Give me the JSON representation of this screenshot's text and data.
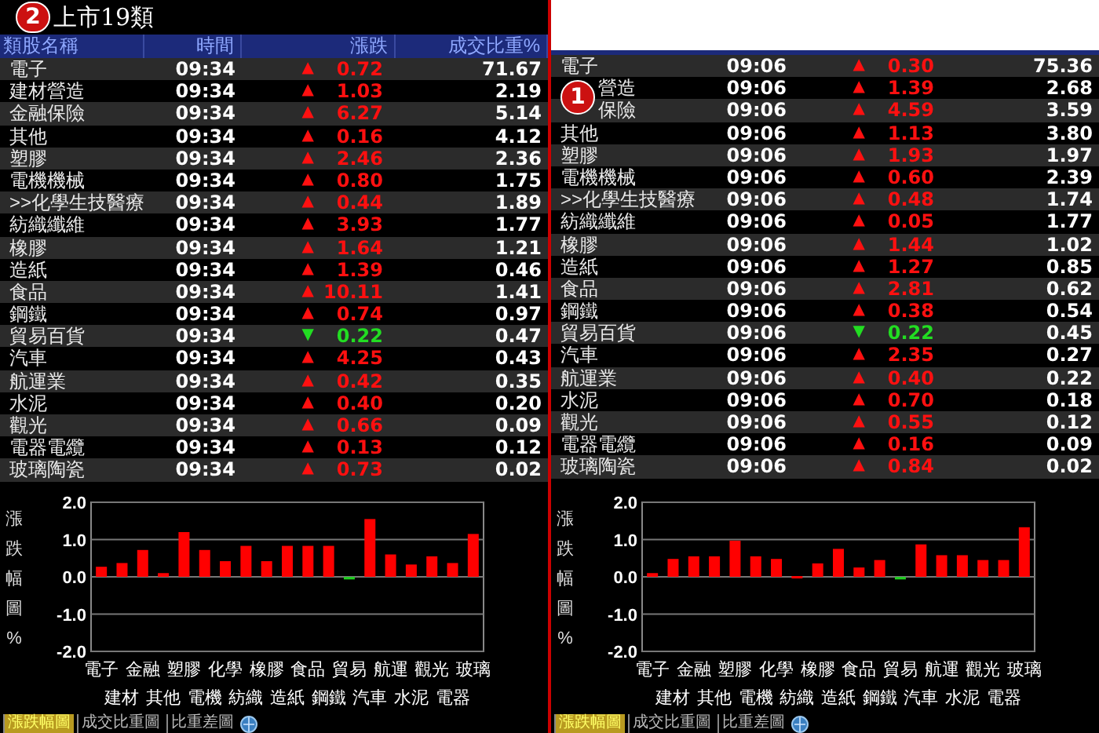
{
  "panels": [
    {
      "title": "上市19類",
      "badge": "2",
      "columns": [
        "類股名稱",
        "時間",
        "漲跌",
        "成交比重%"
      ],
      "rows": [
        {
          "name": "電子",
          "time": "09:34",
          "kind": "up",
          "arrow": "▲",
          "change": "0.72",
          "weight": "71.67"
        },
        {
          "name": "建材營造",
          "time": "09:34",
          "kind": "up",
          "arrow": "▲",
          "change": "1.03",
          "weight": "2.19"
        },
        {
          "name": "金融保險",
          "time": "09:34",
          "kind": "up",
          "arrow": "▲",
          "change": "6.27",
          "weight": "5.14"
        },
        {
          "name": "其他",
          "time": "09:34",
          "kind": "up",
          "arrow": "▲",
          "change": "0.16",
          "weight": "4.12"
        },
        {
          "name": "塑膠",
          "time": "09:34",
          "kind": "up",
          "arrow": "▲",
          "change": "2.46",
          "weight": "2.36"
        },
        {
          "name": "電機機械",
          "time": "09:34",
          "kind": "up",
          "arrow": "▲",
          "change": "0.80",
          "weight": "1.75"
        },
        {
          "name": ">>化學生技醫療",
          "time": "09:34",
          "kind": "up",
          "arrow": "▲",
          "change": "0.44",
          "weight": "1.89"
        },
        {
          "name": "紡織纖維",
          "time": "09:34",
          "kind": "up",
          "arrow": "▲",
          "change": "3.93",
          "weight": "1.77"
        },
        {
          "name": "橡膠",
          "time": "09:34",
          "kind": "up",
          "arrow": "▲",
          "change": "1.64",
          "weight": "1.21"
        },
        {
          "name": "造紙",
          "time": "09:34",
          "kind": "up",
          "arrow": "▲",
          "change": "1.39",
          "weight": "0.46"
        },
        {
          "name": "食品",
          "time": "09:34",
          "kind": "up",
          "arrow": "▲",
          "change": "10.11",
          "weight": "1.41"
        },
        {
          "name": "鋼鐵",
          "time": "09:34",
          "kind": "up",
          "arrow": "▲",
          "change": "0.74",
          "weight": "0.97"
        },
        {
          "name": "貿易百貨",
          "time": "09:34",
          "kind": "down",
          "arrow": "▼",
          "change": "0.22",
          "weight": "0.47"
        },
        {
          "name": "汽車",
          "time": "09:34",
          "kind": "up",
          "arrow": "▲",
          "change": "4.25",
          "weight": "0.43"
        },
        {
          "name": "航運業",
          "time": "09:34",
          "kind": "up",
          "arrow": "▲",
          "change": "0.42",
          "weight": "0.35"
        },
        {
          "name": "水泥",
          "time": "09:34",
          "kind": "up",
          "arrow": "▲",
          "change": "0.40",
          "weight": "0.20"
        },
        {
          "name": "觀光",
          "time": "09:34",
          "kind": "up",
          "arrow": "▲",
          "change": "0.66",
          "weight": "0.09"
        },
        {
          "name": "電器電纜",
          "time": "09:34",
          "kind": "up",
          "arrow": "▲",
          "change": "0.13",
          "weight": "0.12"
        },
        {
          "name": "玻璃陶瓷",
          "time": "09:34",
          "kind": "up",
          "arrow": "▲",
          "change": "0.73",
          "weight": "0.02"
        }
      ],
      "chart_data": {
        "type": "bar",
        "ylabel": "漲跌幅圖%",
        "categories": [
          "電子",
          "建材",
          "金融",
          "其他",
          "塑膠",
          "電機",
          "化學",
          "紡織",
          "橡膠",
          "造紙",
          "食品",
          "鋼鐵",
          "貿易",
          "汽車",
          "航運",
          "水泥",
          "觀光",
          "電器",
          "玻璃"
        ],
        "values": [
          0.27,
          0.37,
          0.72,
          0.1,
          1.2,
          0.72,
          0.42,
          0.83,
          0.42,
          0.83,
          0.83,
          0.83,
          -0.07,
          1.55,
          0.6,
          0.33,
          0.55,
          0.37,
          1.15
        ],
        "ylim": [
          -2,
          2
        ],
        "grid": true,
        "yticks": [
          {
            "value": 2,
            "label": "2.0"
          },
          {
            "value": 1,
            "label": "1.0"
          },
          {
            "value": 0,
            "label": "0.0"
          },
          {
            "value": -1,
            "label": "-1.0"
          },
          {
            "value": -2,
            "label": "-2.0"
          }
        ]
      },
      "tabs": [
        {
          "label": "漲跌幅圖",
          "selected": true
        },
        {
          "label": "成交比重圖",
          "selected": false
        },
        {
          "label": "比重差圖",
          "selected": false
        }
      ]
    },
    {
      "rows": [
        {
          "name": "電子",
          "time": "09:06",
          "kind": "up",
          "arrow": "▲",
          "change": "0.30",
          "weight": "75.36"
        },
        {
          "name": "營造",
          "badge": "1",
          "time": "09:06",
          "kind": "up",
          "arrow": "▲",
          "change": "1.39",
          "weight": "2.68"
        },
        {
          "name": "保險",
          "time": "09:06",
          "kind": "up",
          "arrow": "▲",
          "change": "4.59",
          "weight": "3.59"
        },
        {
          "name": "其他",
          "time": "09:06",
          "kind": "up",
          "arrow": "▲",
          "change": "1.13",
          "weight": "3.80"
        },
        {
          "name": "塑膠",
          "time": "09:06",
          "kind": "up",
          "arrow": "▲",
          "change": "1.93",
          "weight": "1.97"
        },
        {
          "name": "電機機械",
          "time": "09:06",
          "kind": "up",
          "arrow": "▲",
          "change": "0.60",
          "weight": "2.39"
        },
        {
          "name": ">>化學生技醫療",
          "time": "09:06",
          "kind": "up",
          "arrow": "▲",
          "change": "0.48",
          "weight": "1.74"
        },
        {
          "name": "紡織纖維",
          "time": "09:06",
          "kind": "up",
          "arrow": "▲",
          "change": "0.05",
          "weight": "1.77"
        },
        {
          "name": "橡膠",
          "time": "09:06",
          "kind": "up",
          "arrow": "▲",
          "change": "1.44",
          "weight": "1.02"
        },
        {
          "name": "造紙",
          "time": "09:06",
          "kind": "up",
          "arrow": "▲",
          "change": "1.27",
          "weight": "0.85"
        },
        {
          "name": "食品",
          "time": "09:06",
          "kind": "up",
          "arrow": "▲",
          "change": "2.81",
          "weight": "0.62"
        },
        {
          "name": "鋼鐵",
          "time": "09:06",
          "kind": "up",
          "arrow": "▲",
          "change": "0.38",
          "weight": "0.54"
        },
        {
          "name": "貿易百貨",
          "time": "09:06",
          "kind": "down",
          "arrow": "▼",
          "change": "0.22",
          "weight": "0.45"
        },
        {
          "name": "汽車",
          "time": "09:06",
          "kind": "up",
          "arrow": "▲",
          "change": "2.35",
          "weight": "0.27"
        },
        {
          "name": "航運業",
          "time": "09:06",
          "kind": "up",
          "arrow": "▲",
          "change": "0.40",
          "weight": "0.22"
        },
        {
          "name": "水泥",
          "time": "09:06",
          "kind": "up",
          "arrow": "▲",
          "change": "0.70",
          "weight": "0.18"
        },
        {
          "name": "觀光",
          "time": "09:06",
          "kind": "up",
          "arrow": "▲",
          "change": "0.55",
          "weight": "0.12"
        },
        {
          "name": "電器電纜",
          "time": "09:06",
          "kind": "up",
          "arrow": "▲",
          "change": "0.16",
          "weight": "0.09"
        },
        {
          "name": "玻璃陶瓷",
          "time": "09:06",
          "kind": "up",
          "arrow": "▲",
          "change": "0.84",
          "weight": "0.02"
        }
      ],
      "chart_data": {
        "type": "bar",
        "ylabel": "漲跌幅圖%",
        "categories": [
          "電子",
          "建材",
          "金融",
          "其他",
          "塑膠",
          "電機",
          "化學",
          "紡織",
          "橡膠",
          "造紙",
          "食品",
          "鋼鐵",
          "貿易",
          "汽車",
          "航運",
          "水泥",
          "觀光",
          "電器",
          "玻璃"
        ],
        "values": [
          0.1,
          0.48,
          0.55,
          0.55,
          0.97,
          0.55,
          0.48,
          0.02,
          0.36,
          0.75,
          0.25,
          0.45,
          -0.07,
          0.87,
          0.58,
          0.58,
          0.45,
          0.45,
          1.33
        ],
        "ylim": [
          -2,
          2
        ],
        "grid": true,
        "yticks": [
          {
            "value": 2,
            "label": "2.0"
          },
          {
            "value": 1,
            "label": "1.0"
          },
          {
            "value": 0,
            "label": "0.0"
          },
          {
            "value": -1,
            "label": "-1.0"
          },
          {
            "value": -2,
            "label": "-2.0"
          }
        ]
      },
      "tabs": [
        {
          "label": "漲跌幅圖",
          "selected": true
        },
        {
          "label": "成交比重圖",
          "selected": false
        },
        {
          "label": "比重差圖",
          "selected": false
        }
      ]
    }
  ]
}
